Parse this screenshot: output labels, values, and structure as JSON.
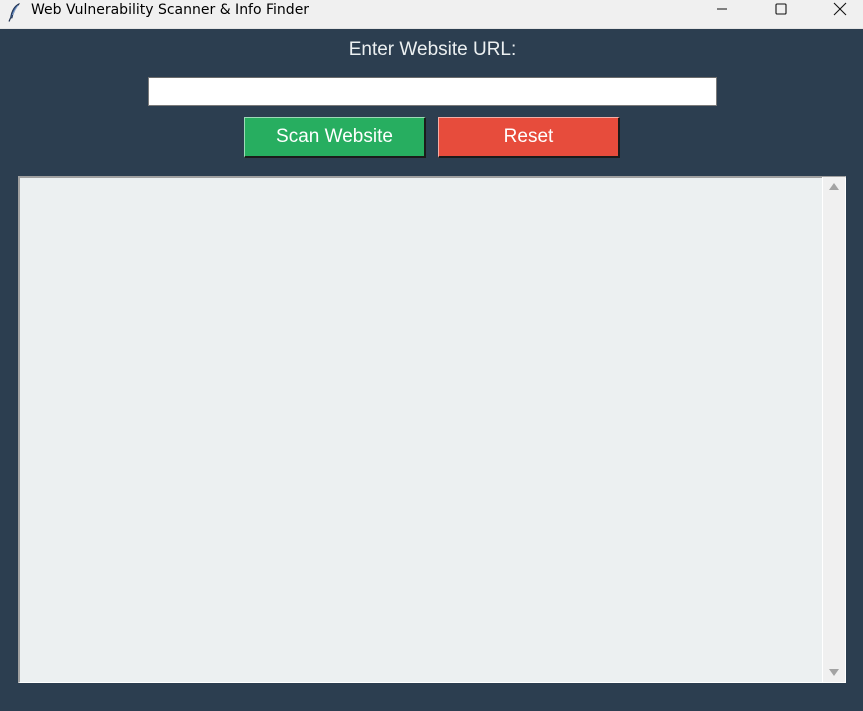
{
  "window": {
    "title": "Web Vulnerability Scanner & Info Finder",
    "app_icon": "feather-icon",
    "controls": {
      "minimize_icon": "minimize-icon",
      "maximize_icon": "maximize-icon",
      "close_icon": "close-icon"
    }
  },
  "form": {
    "url_label": "Enter Website URL:",
    "url_value": "",
    "url_placeholder": ""
  },
  "buttons": {
    "scan_label": "Scan Website",
    "reset_label": "Reset"
  },
  "output": {
    "text": ""
  },
  "colors": {
    "background": "#2c3e50",
    "label_text": "#ecf0f1",
    "scan_button": "#27ae60",
    "reset_button": "#e74c3c",
    "output_background": "#ecf0f1"
  }
}
